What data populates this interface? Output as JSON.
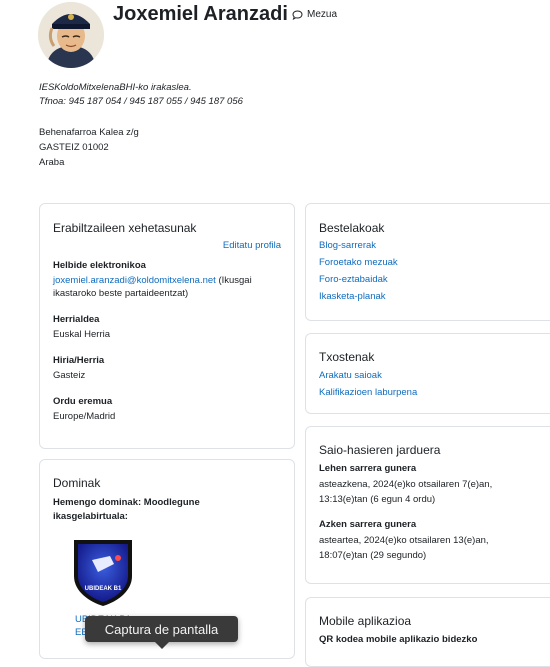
{
  "profile": {
    "name": "Joxemiel Aranzadi",
    "message_label": "Mezua",
    "description_line1": "IESKoldoMitxelenaBHI-ko irakaslea.",
    "description_line2": "Tfnoa: 945 187 054 / 945 187 055 / 945 187 056",
    "address_line1": "Behenafarroa Kalea z/g",
    "address_line2": "GASTEIZ 01002",
    "address_line3": "Araba"
  },
  "user_details": {
    "title": "Erabiltzaileen xehetasunak",
    "edit_link": "Editatu profila",
    "email_label": "Helbide elektronikoa",
    "email_value": "joxemiel.aranzadi@koldomitxelena.net",
    "email_note": "(Ikusgai ikastaroko beste partaideentzat)",
    "country_label": "Herrialdea",
    "country_value": "Euskal Herria",
    "city_label": "Hiria/Herria",
    "city_value": "Gasteiz",
    "timezone_label": "Ordu eremua",
    "timezone_value": "Europe/Madrid"
  },
  "domains": {
    "title": "Dominak",
    "subtitle": "Hemengo dominak: Moodlegune ikasgelabirtuala:",
    "badge_text": "UBIDEAK B1",
    "badge_link_line1": "UBIDEAK B1",
    "badge_link_line2": "EB"
  },
  "misc": {
    "title": "Bestelakoak",
    "links": [
      "Blog-sarrerak",
      "Foroetako mezuak",
      "Foro-eztabaidak",
      "Ikasketa-planak"
    ]
  },
  "reports": {
    "title": "Txostenak",
    "links": [
      "Arakatu saioak",
      "Kalifikazioen laburpena"
    ]
  },
  "login_activity": {
    "title": "Saio-hasieren jarduera",
    "first_label": "Lehen sarrera gunera",
    "first_value": "asteazkena, 2024(e)ko otsailaren 7(e)an, 13:13(e)tan  (6 egun 4 ordu)",
    "last_label": "Azken sarrera gunera",
    "last_value": "asteartea, 2024(e)ko otsailaren 13(e)an, 18:07(e)tan  (29 segundo)"
  },
  "mobile": {
    "title": "Mobile aplikazioa",
    "qr_label": "QR kodea mobile aplikazio bidezko"
  },
  "tooltip": {
    "text": "Captura de pantalla"
  },
  "colors": {
    "link": "#0f6cbf",
    "border": "#dee2e6",
    "tooltip_bg": "#3a3a3a"
  }
}
